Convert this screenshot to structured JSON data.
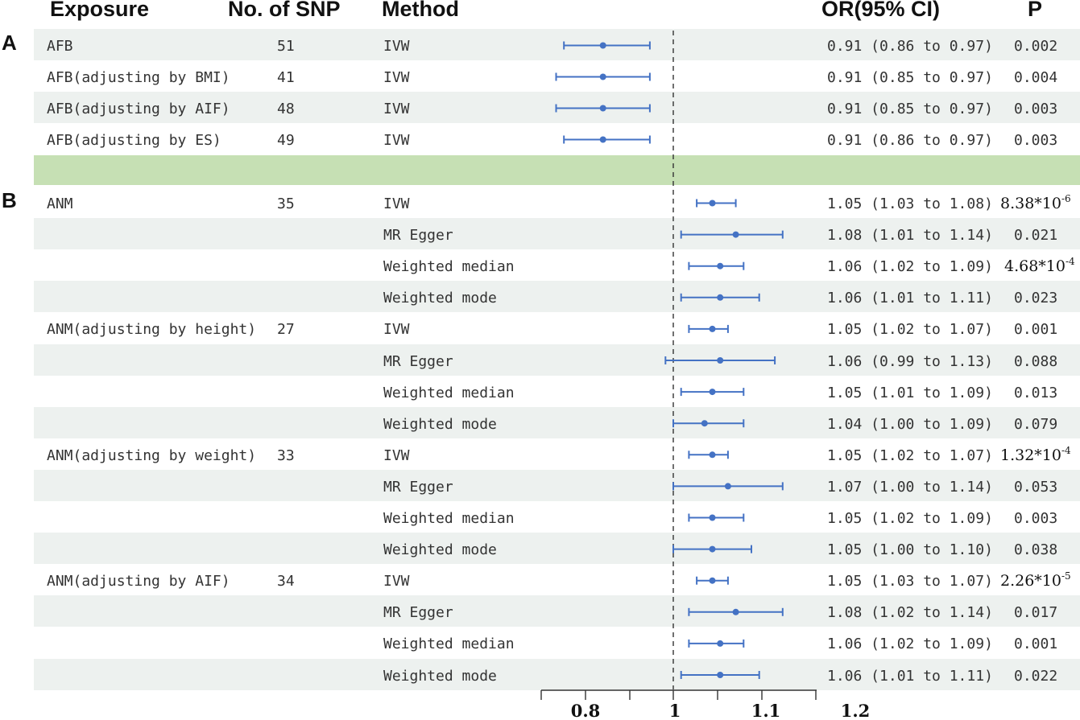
{
  "headers": {
    "exposure": "Exposure",
    "nsnp": "No. of SNP",
    "method": "Method",
    "or": "OR(95% CI)",
    "p": "P"
  },
  "panels": {
    "a": "A",
    "b": "B"
  },
  "colors": {
    "estimate": "#4472c4",
    "row_shade": "#edf1ef",
    "separator": "#c6e0b4"
  },
  "chart_data": {
    "type": "forest",
    "reference_line": 1,
    "reference_style": "dashed",
    "x_ticks": [
      0.8,
      1,
      1.1,
      1.2
    ],
    "x_tick_labels": [
      "0.8",
      "1",
      "1.1",
      "1.2"
    ],
    "xlim": [
      0.72,
      1.15
    ],
    "rows": [
      {
        "exposure": "AFB",
        "nsnp": "51",
        "method": "IVW",
        "or": 0.91,
        "lo": 0.86,
        "hi": 0.97,
        "or_text": "0.91 (0.86 to 0.97)",
        "p_text": "0.002"
      },
      {
        "exposure": "AFB(adjusting by BMI)",
        "nsnp": "41",
        "method": "IVW",
        "or": 0.91,
        "lo": 0.85,
        "hi": 0.97,
        "or_text": "0.91 (0.85 to 0.97)",
        "p_text": "0.004"
      },
      {
        "exposure": "AFB(adjusting by AIF)",
        "nsnp": "48",
        "method": "IVW",
        "or": 0.91,
        "lo": 0.85,
        "hi": 0.97,
        "or_text": "0.91 (0.85 to 0.97)",
        "p_text": "0.003"
      },
      {
        "exposure": "AFB(adjusting by ES)",
        "nsnp": "49",
        "method": "IVW",
        "or": 0.91,
        "lo": 0.86,
        "hi": 0.97,
        "or_text": "0.91 (0.86 to 0.97)",
        "p_text": "0.003"
      },
      {
        "exposure": "ANM",
        "nsnp": "35",
        "method": "IVW",
        "or": 1.05,
        "lo": 1.03,
        "hi": 1.08,
        "or_text": "1.05 (1.03 to 1.08)",
        "p_text": "8.38*10",
        "p_exp": "-6"
      },
      {
        "exposure": "",
        "nsnp": "",
        "method": "MR Egger",
        "or": 1.08,
        "lo": 1.01,
        "hi": 1.14,
        "or_text": "1.08 (1.01 to 1.14)",
        "p_text": "0.021"
      },
      {
        "exposure": "",
        "nsnp": "",
        "method": "Weighted median",
        "or": 1.06,
        "lo": 1.02,
        "hi": 1.09,
        "or_text": "1.06 (1.02 to 1.09)",
        "p_text": "4.68*10",
        "p_exp": "-4"
      },
      {
        "exposure": "",
        "nsnp": "",
        "method": "Weighted mode",
        "or": 1.06,
        "lo": 1.01,
        "hi": 1.11,
        "or_text": "1.06 (1.01 to 1.11)",
        "p_text": "0.023"
      },
      {
        "exposure": "ANM(adjusting by height)",
        "nsnp": "27",
        "method": "IVW",
        "or": 1.05,
        "lo": 1.02,
        "hi": 1.07,
        "or_text": "1.05 (1.02 to 1.07)",
        "p_text": "0.001"
      },
      {
        "exposure": "",
        "nsnp": "",
        "method": "MR Egger",
        "or": 1.06,
        "lo": 0.99,
        "hi": 1.13,
        "or_text": "1.06 (0.99 to 1.13)",
        "p_text": "0.088"
      },
      {
        "exposure": "",
        "nsnp": "",
        "method": "Weighted median",
        "or": 1.05,
        "lo": 1.01,
        "hi": 1.09,
        "or_text": "1.05 (1.01 to 1.09)",
        "p_text": "0.013"
      },
      {
        "exposure": "",
        "nsnp": "",
        "method": "Weighted mode",
        "or": 1.04,
        "lo": 1.0,
        "hi": 1.09,
        "or_text": "1.04 (1.00 to 1.09)",
        "p_text": "0.079"
      },
      {
        "exposure": "ANM(adjusting by weight)",
        "nsnp": "33",
        "method": "IVW",
        "or": 1.05,
        "lo": 1.02,
        "hi": 1.07,
        "or_text": "1.05 (1.02 to 1.07)",
        "p_text": "1.32*10",
        "p_exp": "-4"
      },
      {
        "exposure": "",
        "nsnp": "",
        "method": "MR Egger",
        "or": 1.07,
        "lo": 1.0,
        "hi": 1.14,
        "or_text": "1.07 (1.00 to 1.14)",
        "p_text": "0.053"
      },
      {
        "exposure": "",
        "nsnp": "",
        "method": "Weighted median",
        "or": 1.05,
        "lo": 1.02,
        "hi": 1.09,
        "or_text": "1.05 (1.02 to 1.09)",
        "p_text": "0.003"
      },
      {
        "exposure": "",
        "nsnp": "",
        "method": "Weighted mode",
        "or": 1.05,
        "lo": 1.0,
        "hi": 1.1,
        "or_text": "1.05 (1.00 to 1.10)",
        "p_text": "0.038"
      },
      {
        "exposure": "ANM(adjusting by AIF)",
        "nsnp": "34",
        "method": "IVW",
        "or": 1.05,
        "lo": 1.03,
        "hi": 1.07,
        "or_text": "1.05 (1.03 to 1.07)",
        "p_text": "2.26*10",
        "p_exp": "-5"
      },
      {
        "exposure": "",
        "nsnp": "",
        "method": "MR Egger",
        "or": 1.08,
        "lo": 1.02,
        "hi": 1.14,
        "or_text": "1.08 (1.02 to 1.14)",
        "p_text": "0.017"
      },
      {
        "exposure": "",
        "nsnp": "",
        "method": "Weighted median",
        "or": 1.06,
        "lo": 1.02,
        "hi": 1.09,
        "or_text": "1.06 (1.02 to 1.09)",
        "p_text": "0.001"
      },
      {
        "exposure": "",
        "nsnp": "",
        "method": "Weighted mode",
        "or": 1.06,
        "lo": 1.01,
        "hi": 1.11,
        "or_text": "1.06 (1.01 to 1.11)",
        "p_text": "0.022"
      }
    ]
  }
}
